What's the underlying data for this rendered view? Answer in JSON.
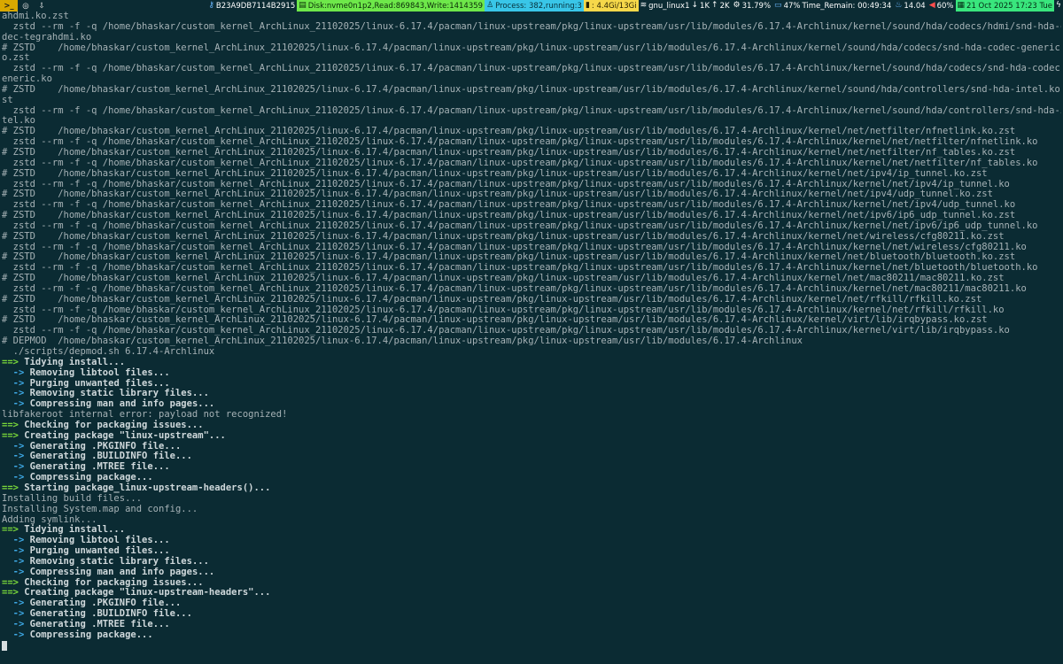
{
  "statusbar": {
    "workspace_active": ">_",
    "workspace_2": "◎",
    "workspace_3": "⇩",
    "host_id": "B23A9DB7114B2915",
    "disk": "Disk:nvme0n1p2,Read:869843,Write:1414359",
    "process": "Process: 382,running:3",
    "memory": ": 4.4Gi/13Gi",
    "network": "gnu_linux1",
    "net_down": "1K",
    "net_up": "2K",
    "cpu": "31.79%",
    "battery": "47%",
    "time_remaining": "Time_Remain: 00:49:34",
    "temperature": "14.04",
    "volume": "60%",
    "datetime": "21 Oct 2025 17:23 Tue",
    "icons": {
      "host": "key-icon",
      "process": "tux-icon",
      "memory": "memory-chart-icon",
      "wifi": "wifi-icon",
      "cpu": "gear-icon",
      "battery": "battery-icon",
      "temp": "thermometer-icon",
      "volume": "speaker-icon",
      "calendar": "calendar-icon",
      "power": "bolt-icon"
    },
    "colors": {
      "background": "#0b2b33",
      "workspace_active": "#d9a800",
      "disk": "#6ee84a",
      "process": "#39c6e8",
      "memory": "#f6d84a",
      "date": "#39e67d"
    }
  },
  "terminal": {
    "colors": {
      "background": "#0b2b33",
      "text": "#a6b2b6",
      "marker_green": "#7bd93a",
      "arrow_blue": "#3ea9e6"
    },
    "lines": [
      {
        "kind": "plain",
        "text": "ahdmi.ko.zst"
      },
      {
        "kind": "plain",
        "text": "  zstd --rm -f -q /home/bhaskar/custom_kernel_ArchLinux_21102025/linux-6.17.4/pacman/linux-upstream/pkg/linux-upstream/usr/lib/modules/6.17.4-Archlinux/kernel/sound/hda/codecs/hdmi/snd-hda-co"
      },
      {
        "kind": "plain",
        "text": "dec-tegrahdmi.ko"
      },
      {
        "kind": "plain",
        "text": "# ZSTD    /home/bhaskar/custom_kernel_ArchLinux_21102025/linux-6.17.4/pacman/linux-upstream/pkg/linux-upstream/usr/lib/modules/6.17.4-Archlinux/kernel/sound/hda/codecs/snd-hda-codec-generic.k"
      },
      {
        "kind": "plain",
        "text": "o.zst"
      },
      {
        "kind": "plain",
        "text": "  zstd --rm -f -q /home/bhaskar/custom_kernel_ArchLinux_21102025/linux-6.17.4/pacman/linux-upstream/pkg/linux-upstream/usr/lib/modules/6.17.4-Archlinux/kernel/sound/hda/codecs/snd-hda-codec-g"
      },
      {
        "kind": "plain",
        "text": "eneric.ko"
      },
      {
        "kind": "plain",
        "text": "# ZSTD    /home/bhaskar/custom_kernel_ArchLinux_21102025/linux-6.17.4/pacman/linux-upstream/pkg/linux-upstream/usr/lib/modules/6.17.4-Archlinux/kernel/sound/hda/controllers/snd-hda-intel.ko.z"
      },
      {
        "kind": "plain",
        "text": "st"
      },
      {
        "kind": "plain",
        "text": "  zstd --rm -f -q /home/bhaskar/custom_kernel_ArchLinux_21102025/linux-6.17.4/pacman/linux-upstream/pkg/linux-upstream/usr/lib/modules/6.17.4-Archlinux/kernel/sound/hda/controllers/snd-hda-in"
      },
      {
        "kind": "plain",
        "text": "tel.ko"
      },
      {
        "kind": "plain",
        "text": "# ZSTD    /home/bhaskar/custom_kernel_ArchLinux_21102025/linux-6.17.4/pacman/linux-upstream/pkg/linux-upstream/usr/lib/modules/6.17.4-Archlinux/kernel/net/netfilter/nfnetlink.ko.zst"
      },
      {
        "kind": "plain",
        "text": "  zstd --rm -f -q /home/bhaskar/custom_kernel_ArchLinux_21102025/linux-6.17.4/pacman/linux-upstream/pkg/linux-upstream/usr/lib/modules/6.17.4-Archlinux/kernel/net/netfilter/nfnetlink.ko"
      },
      {
        "kind": "plain",
        "text": "# ZSTD    /home/bhaskar/custom_kernel_ArchLinux_21102025/linux-6.17.4/pacman/linux-upstream/pkg/linux-upstream/usr/lib/modules/6.17.4-Archlinux/kernel/net/netfilter/nf_tables.ko.zst"
      },
      {
        "kind": "plain",
        "text": "  zstd --rm -f -q /home/bhaskar/custom_kernel_ArchLinux_21102025/linux-6.17.4/pacman/linux-upstream/pkg/linux-upstream/usr/lib/modules/6.17.4-Archlinux/kernel/net/netfilter/nf_tables.ko"
      },
      {
        "kind": "plain",
        "text": "# ZSTD    /home/bhaskar/custom_kernel_ArchLinux_21102025/linux-6.17.4/pacman/linux-upstream/pkg/linux-upstream/usr/lib/modules/6.17.4-Archlinux/kernel/net/ipv4/ip_tunnel.ko.zst"
      },
      {
        "kind": "plain",
        "text": "  zstd --rm -f -q /home/bhaskar/custom_kernel_ArchLinux_21102025/linux-6.17.4/pacman/linux-upstream/pkg/linux-upstream/usr/lib/modules/6.17.4-Archlinux/kernel/net/ipv4/ip_tunnel.ko"
      },
      {
        "kind": "plain",
        "text": "# ZSTD    /home/bhaskar/custom_kernel_ArchLinux_21102025/linux-6.17.4/pacman/linux-upstream/pkg/linux-upstream/usr/lib/modules/6.17.4-Archlinux/kernel/net/ipv4/udp_tunnel.ko.zst"
      },
      {
        "kind": "plain",
        "text": "  zstd --rm -f -q /home/bhaskar/custom_kernel_ArchLinux_21102025/linux-6.17.4/pacman/linux-upstream/pkg/linux-upstream/usr/lib/modules/6.17.4-Archlinux/kernel/net/ipv4/udp_tunnel.ko"
      },
      {
        "kind": "plain",
        "text": "# ZSTD    /home/bhaskar/custom_kernel_ArchLinux_21102025/linux-6.17.4/pacman/linux-upstream/pkg/linux-upstream/usr/lib/modules/6.17.4-Archlinux/kernel/net/ipv6/ip6_udp_tunnel.ko.zst"
      },
      {
        "kind": "plain",
        "text": "  zstd --rm -f -q /home/bhaskar/custom_kernel_ArchLinux_21102025/linux-6.17.4/pacman/linux-upstream/pkg/linux-upstream/usr/lib/modules/6.17.4-Archlinux/kernel/net/ipv6/ip6_udp_tunnel.ko"
      },
      {
        "kind": "plain",
        "text": "# ZSTD    /home/bhaskar/custom_kernel_ArchLinux_21102025/linux-6.17.4/pacman/linux-upstream/pkg/linux-upstream/usr/lib/modules/6.17.4-Archlinux/kernel/net/wireless/cfg80211.ko.zst"
      },
      {
        "kind": "plain",
        "text": "  zstd --rm -f -q /home/bhaskar/custom_kernel_ArchLinux_21102025/linux-6.17.4/pacman/linux-upstream/pkg/linux-upstream/usr/lib/modules/6.17.4-Archlinux/kernel/net/wireless/cfg80211.ko"
      },
      {
        "kind": "plain",
        "text": "# ZSTD    /home/bhaskar/custom_kernel_ArchLinux_21102025/linux-6.17.4/pacman/linux-upstream/pkg/linux-upstream/usr/lib/modules/6.17.4-Archlinux/kernel/net/bluetooth/bluetooth.ko.zst"
      },
      {
        "kind": "plain",
        "text": "  zstd --rm -f -q /home/bhaskar/custom_kernel_ArchLinux_21102025/linux-6.17.4/pacman/linux-upstream/pkg/linux-upstream/usr/lib/modules/6.17.4-Archlinux/kernel/net/bluetooth/bluetooth.ko"
      },
      {
        "kind": "plain",
        "text": "# ZSTD    /home/bhaskar/custom_kernel_ArchLinux_21102025/linux-6.17.4/pacman/linux-upstream/pkg/linux-upstream/usr/lib/modules/6.17.4-Archlinux/kernel/net/mac80211/mac80211.ko.zst"
      },
      {
        "kind": "plain",
        "text": "  zstd --rm -f -q /home/bhaskar/custom_kernel_ArchLinux_21102025/linux-6.17.4/pacman/linux-upstream/pkg/linux-upstream/usr/lib/modules/6.17.4-Archlinux/kernel/net/mac80211/mac80211.ko"
      },
      {
        "kind": "plain",
        "text": "# ZSTD    /home/bhaskar/custom_kernel_ArchLinux_21102025/linux-6.17.4/pacman/linux-upstream/pkg/linux-upstream/usr/lib/modules/6.17.4-Archlinux/kernel/net/rfkill/rfkill.ko.zst"
      },
      {
        "kind": "plain",
        "text": "  zstd --rm -f -q /home/bhaskar/custom_kernel_ArchLinux_21102025/linux-6.17.4/pacman/linux-upstream/pkg/linux-upstream/usr/lib/modules/6.17.4-Archlinux/kernel/net/rfkill/rfkill.ko"
      },
      {
        "kind": "plain",
        "text": "# ZSTD    /home/bhaskar/custom_kernel_ArchLinux_21102025/linux-6.17.4/pacman/linux-upstream/pkg/linux-upstream/usr/lib/modules/6.17.4-Archlinux/kernel/virt/lib/irqbypass.ko.zst"
      },
      {
        "kind": "plain",
        "text": "  zstd --rm -f -q /home/bhaskar/custom_kernel_ArchLinux_21102025/linux-6.17.4/pacman/linux-upstream/pkg/linux-upstream/usr/lib/modules/6.17.4-Archlinux/kernel/virt/lib/irqbypass.ko"
      },
      {
        "kind": "plain",
        "text": "# DEPMOD  /home/bhaskar/custom_kernel_ArchLinux_21102025/linux-6.17.4/pacman/linux-upstream/pkg/linux-upstream/usr/lib/modules/6.17.4-Archlinux"
      },
      {
        "kind": "plain",
        "text": "  ./scripts/depmod.sh 6.17.4-Archlinux"
      },
      {
        "kind": "mark",
        "marker": "==>",
        "text": " Tidying install..."
      },
      {
        "kind": "arrow",
        "marker": "  ->",
        "text": " Removing libtool files..."
      },
      {
        "kind": "arrow",
        "marker": "  ->",
        "text": " Purging unwanted files..."
      },
      {
        "kind": "arrow",
        "marker": "  ->",
        "text": " Removing static library files..."
      },
      {
        "kind": "arrow",
        "marker": "  ->",
        "text": " Compressing man and info pages..."
      },
      {
        "kind": "plain",
        "text": "libfakeroot internal error: payload not recognized!"
      },
      {
        "kind": "mark",
        "marker": "==>",
        "text": " Checking for packaging issues..."
      },
      {
        "kind": "mark",
        "marker": "==>",
        "text": " Creating package \"linux-upstream\"..."
      },
      {
        "kind": "arrow",
        "marker": "  ->",
        "text": " Generating .PKGINFO file..."
      },
      {
        "kind": "arrow",
        "marker": "  ->",
        "text": " Generating .BUILDINFO file..."
      },
      {
        "kind": "arrow",
        "marker": "  ->",
        "text": " Generating .MTREE file..."
      },
      {
        "kind": "arrow",
        "marker": "  ->",
        "text": " Compressing package..."
      },
      {
        "kind": "mark",
        "marker": "==>",
        "text": " Starting package_linux-upstream-headers()..."
      },
      {
        "kind": "plain",
        "text": "Installing build files..."
      },
      {
        "kind": "plain",
        "text": "Installing System.map and config..."
      },
      {
        "kind": "plain",
        "text": "Adding symlink..."
      },
      {
        "kind": "mark",
        "marker": "==>",
        "text": " Tidying install..."
      },
      {
        "kind": "arrow",
        "marker": "  ->",
        "text": " Removing libtool files..."
      },
      {
        "kind": "arrow",
        "marker": "  ->",
        "text": " Purging unwanted files..."
      },
      {
        "kind": "arrow",
        "marker": "  ->",
        "text": " Removing static library files..."
      },
      {
        "kind": "arrow",
        "marker": "  ->",
        "text": " Compressing man and info pages..."
      },
      {
        "kind": "mark",
        "marker": "==>",
        "text": " Checking for packaging issues..."
      },
      {
        "kind": "mark",
        "marker": "==>",
        "text": " Creating package \"linux-upstream-headers\"..."
      },
      {
        "kind": "arrow",
        "marker": "  ->",
        "text": " Generating .PKGINFO file..."
      },
      {
        "kind": "arrow",
        "marker": "  ->",
        "text": " Generating .BUILDINFO file..."
      },
      {
        "kind": "arrow",
        "marker": "  ->",
        "text": " Generating .MTREE file..."
      },
      {
        "kind": "arrow",
        "marker": "  ->",
        "text": " Compressing package..."
      }
    ]
  }
}
